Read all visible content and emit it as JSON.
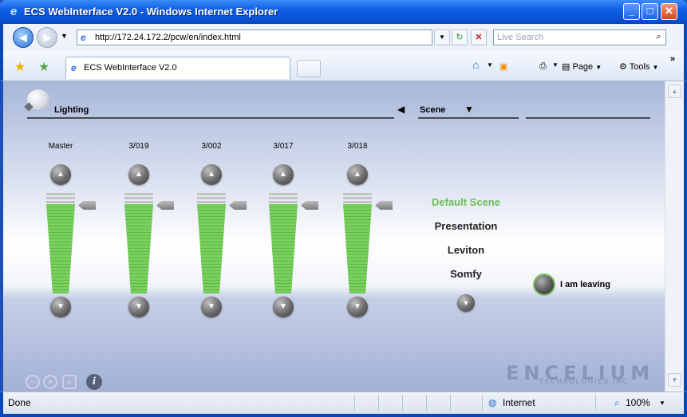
{
  "window": {
    "title": "ECS WebInterface V2.0 - Windows Internet Explorer"
  },
  "address_bar": {
    "url": "http://172.24.172.2/pcw/en/index.html",
    "search_placeholder": "Live Search"
  },
  "tab": {
    "label": "ECS WebInterface V2.0"
  },
  "command_bar": {
    "page_label": "Page",
    "tools_label": "Tools"
  },
  "app": {
    "lighting_title": "Lighting",
    "scene_title": "Scene",
    "channels": [
      {
        "label": "Master",
        "level": 1.0
      },
      {
        "label": "3/019",
        "level": 1.0
      },
      {
        "label": "3/002",
        "level": 1.0
      },
      {
        "label": "3/017",
        "level": 1.0
      },
      {
        "label": "3/018",
        "level": 1.0
      }
    ],
    "scenes": [
      {
        "label": "Default Scene",
        "active": true
      },
      {
        "label": "Presentation",
        "active": false
      },
      {
        "label": "Leviton",
        "active": false
      },
      {
        "label": "Somfy",
        "active": false
      }
    ],
    "leave_label": "I am leaving",
    "brand_name": "ENCELIUM",
    "brand_sub": "TECHNOLOGIES INC."
  },
  "status_bar": {
    "status": "Done",
    "zone": "Internet",
    "zoom": "100%"
  },
  "colors": {
    "active_scene": "#6fbf58",
    "slider_fill": "#7ad05d",
    "titlebar": "#0a4fd0"
  }
}
